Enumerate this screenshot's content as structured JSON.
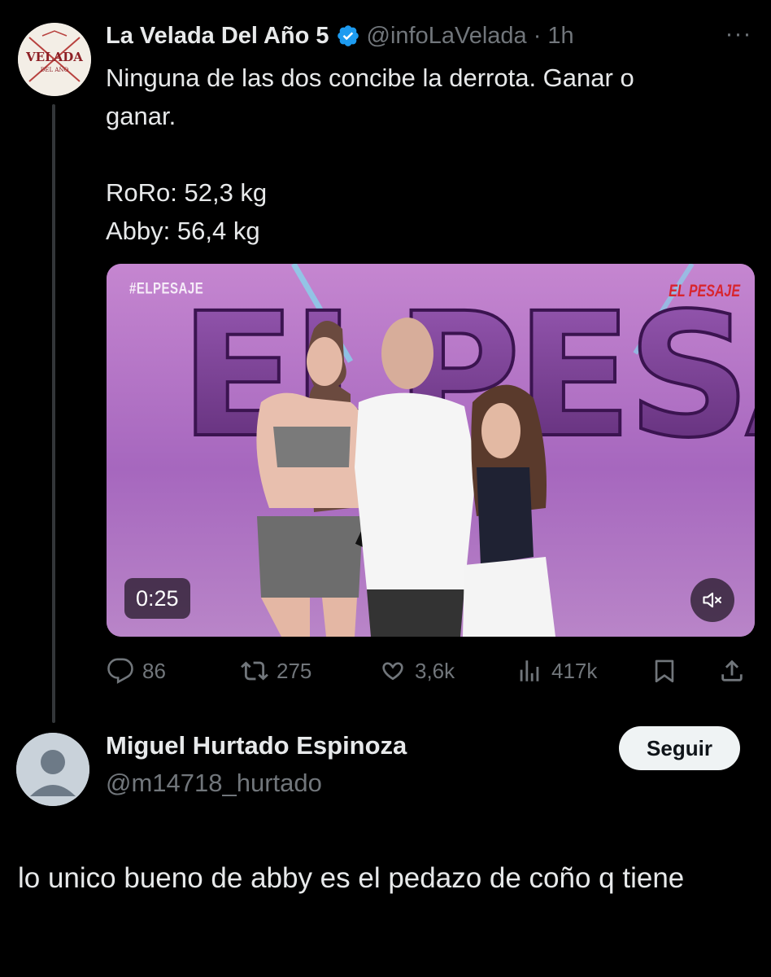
{
  "tweet": {
    "author_name": "La Velada Del Año 5",
    "handle": "@infoLaVelada",
    "separator": "·",
    "time": "1h",
    "more": "···",
    "text_line1": "Ninguna de las dos concibe la derrota. Ganar o\nganar.",
    "text_line2": "RoRo: 52,3 kg",
    "text_line3": "Abby: 56,4 kg",
    "verified_color": "#1d9bf0",
    "media": {
      "hashtag_overlay": "#ELPESAJE",
      "brand_overlay": "EL PESAJE",
      "backdrop_letters": "ELPESAJE",
      "duration": "0:25",
      "muted": true
    },
    "actions": {
      "replies": "86",
      "retweets": "275",
      "likes": "3,6k",
      "views": "417k"
    },
    "avatar_logo_text": "VELADA",
    "avatar_logo_subtext": "DEL AÑO"
  },
  "reply": {
    "author_name": "Miguel Hurtado Espinoza",
    "handle": "@m14718_hurtado",
    "follow_label": "Seguir",
    "text": "lo unico bueno de abby es el pedazo de coño q tiene"
  },
  "colors": {
    "background": "#000000",
    "text_primary": "#e7e9ea",
    "text_secondary": "#71767b",
    "follow_bg": "#eff3f4"
  },
  "icons": [
    "reply-icon",
    "retweet-icon",
    "like-icon",
    "views-icon",
    "bookmark-icon",
    "share-icon",
    "verified-badge-icon",
    "mute-icon",
    "more-icon"
  ]
}
